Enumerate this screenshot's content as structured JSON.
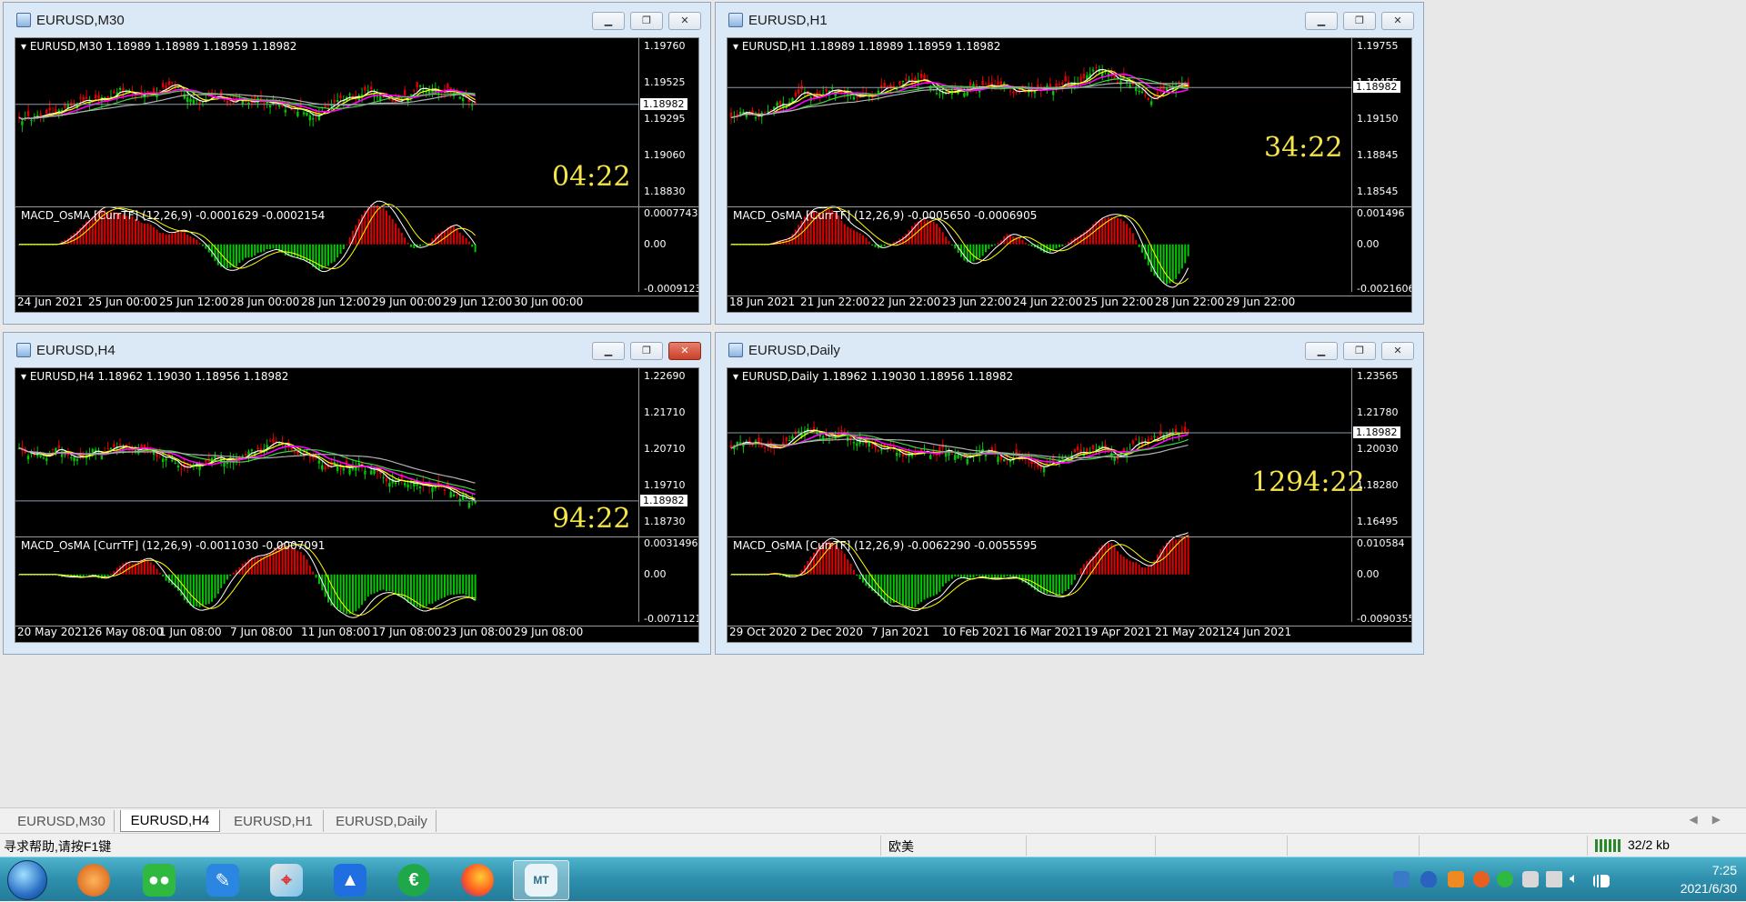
{
  "windows": [
    {
      "key": "m30",
      "title": "EURUSD,M30",
      "header": "EURUSD,M30  1.18989 1.18989 1.18959 1.18982",
      "indicator": "MACD_OsMA [CurrTF] (12,26,9) -0.0001629 -0.0002154",
      "countdown": "04:22",
      "price_box": "1.18982",
      "prices": [
        "1.19760",
        "1.19525",
        "1.19295",
        "1.19060",
        "1.18830"
      ],
      "ind_scale": [
        "0.0007743",
        "0.00",
        "-0.0009123"
      ],
      "times": [
        "24 Jun 2021",
        "25 Jun 00:00",
        "25 Jun 12:00",
        "28 Jun 00:00",
        "28 Jun 12:00",
        "29 Jun 00:00",
        "29 Jun 12:00",
        "30 Jun 00:00"
      ],
      "close_red": false
    },
    {
      "key": "h1",
      "title": "EURUSD,H1",
      "header": "EURUSD,H1  1.18989 1.18989 1.18959 1.18982",
      "indicator": "MACD_OsMA [CurrTF] (12,26,9) -0.0005650 -0.0006905",
      "countdown": "34:22",
      "price_box": "1.18982",
      "prices": [
        "1.19755",
        "1.19455",
        "1.19150",
        "1.18845",
        "1.18545"
      ],
      "ind_scale": [
        "0.001496",
        "0.00",
        "-0.0021606"
      ],
      "times": [
        "18 Jun 2021",
        "21 Jun 22:00",
        "22 Jun 22:00",
        "23 Jun 22:00",
        "24 Jun 22:00",
        "25 Jun 22:00",
        "28 Jun 22:00",
        "29 Jun 22:00"
      ],
      "close_red": false
    },
    {
      "key": "h4",
      "title": "EURUSD,H4",
      "header": "EURUSD,H4  1.18962 1.19030 1.18956 1.18982",
      "indicator": "MACD_OsMA [CurrTF] (12,26,9) -0.0011030 -0.0007091",
      "countdown": "94:22",
      "price_box": "1.18982",
      "prices": [
        "1.22690",
        "1.21710",
        "1.20710",
        "1.19710",
        "1.18730"
      ],
      "ind_scale": [
        "0.0031496",
        "0.00",
        "-0.0071121"
      ],
      "times": [
        "20 May 2021",
        "26 May 08:00",
        "1 Jun 08:00",
        "7 Jun 08:00",
        "11 Jun 08:00",
        "17 Jun 08:00",
        "23 Jun 08:00",
        "29 Jun 08:00"
      ],
      "close_red": true
    },
    {
      "key": "d1",
      "title": "EURUSD,Daily",
      "header": "EURUSD,Daily  1.18962 1.19030 1.18956 1.18982",
      "indicator": "MACD_OsMA [CurrTF] (12,26,9) -0.0062290 -0.0055595",
      "countdown": "1294:22",
      "price_box": "1.18982",
      "prices": [
        "1.23565",
        "1.21780",
        "1.20030",
        "1.18280",
        "1.16495"
      ],
      "ind_scale": [
        "0.010584",
        "0.00",
        "-0.0090355"
      ],
      "times": [
        "29 Oct 2020",
        "2 Dec 2020",
        "7 Jan 2021",
        "10 Feb 2021",
        "16 Mar 2021",
        "19 Apr 2021",
        "21 May 2021",
        "24 Jun 2021"
      ],
      "close_red": false
    }
  ],
  "tabs": [
    "EURUSD,M30",
    "EURUSD,H4",
    "EURUSD,H1",
    "EURUSD,Daily"
  ],
  "active_tab": "EURUSD,H4",
  "status": {
    "help": "寻求帮助,请按F1键",
    "profile": "欧美",
    "traffic": "32/2 kb"
  },
  "taskbar": {
    "time": "7:25",
    "date": "2021/6/30"
  },
  "colors": {
    "bull": "#00c800",
    "bear": "#e00000",
    "ma_fast": "#ffffff",
    "ma_mid": "#ffff00",
    "ma_magenta": "#ff00ff",
    "ma_green": "#3fd43f",
    "ma_gray": "#b0b0b0",
    "countdown": "#f5e44a"
  }
}
